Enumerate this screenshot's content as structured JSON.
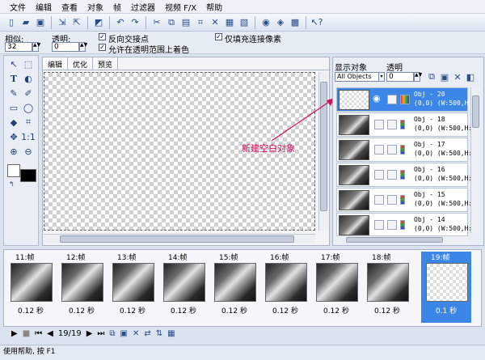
{
  "menu": [
    "文件",
    "编辑",
    "查看",
    "对象",
    "帧",
    "过滤器",
    "视频 F/X",
    "帮助"
  ],
  "options": {
    "tolerance_label": "相似:",
    "tolerance_value": "32",
    "opacity_label": "透明:",
    "opacity_value": "0",
    "cb_reverse": "反向交接点",
    "cb_transparent_fill": "允许在透明范围上着色",
    "cb_fill_connected": "仅填充连接像素"
  },
  "editor": {
    "tabs": [
      "编辑",
      "优化",
      "预览"
    ]
  },
  "objects_panel": {
    "show_label": "显示对象",
    "show_value": "All Objects",
    "opacity_label": "透明",
    "opacity_value": "0",
    "items": [
      {
        "name": "Obj - 20",
        "info": "(0,0) (W:500,H:"
      },
      {
        "name": "Obj - 18",
        "info": "(0,0) (W:500,H:"
      },
      {
        "name": "Obj - 17",
        "info": "(0,0) (W:500,H:"
      },
      {
        "name": "Obj - 16",
        "info": "(0,0) (W:500,H:"
      },
      {
        "name": "Obj - 15",
        "info": "(0,0) (W:500,H:"
      },
      {
        "name": "Obj - 14",
        "info": "(0,0) (W:500,H:"
      }
    ]
  },
  "annotation": "新建空白对象",
  "frames": [
    {
      "label": "11:帧",
      "time": "0.12 秒"
    },
    {
      "label": "12:帧",
      "time": "0.12 秒"
    },
    {
      "label": "13:帧",
      "time": "0.12 秒"
    },
    {
      "label": "14:帧",
      "time": "0.12 秒"
    },
    {
      "label": "15:帧",
      "time": "0.12 秒"
    },
    {
      "label": "16:帧",
      "time": "0.12 秒"
    },
    {
      "label": "17:帧",
      "time": "0.12 秒"
    },
    {
      "label": "18:帧",
      "time": "0.12 秒"
    },
    {
      "label": "19:帧",
      "time": "0.1 秒"
    }
  ],
  "playback": {
    "counter": "19/19"
  },
  "status": "使用帮助, 按 F1",
  "colors": {
    "accent": "#3b86e6",
    "annotation": "#d0105a",
    "foreground": "#000000",
    "background": "#ffffff"
  }
}
